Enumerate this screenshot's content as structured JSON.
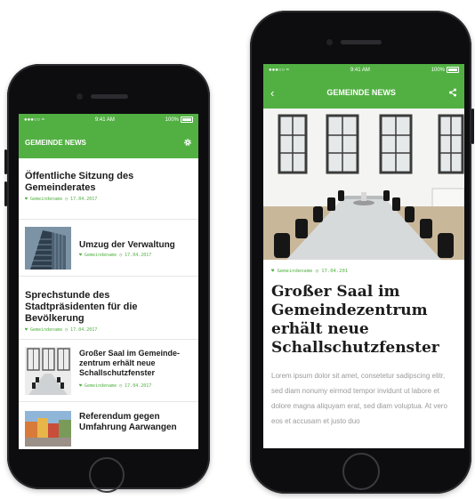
{
  "left_phone": {
    "status": {
      "carrier": "●●●○○ ≈",
      "time": "9:41 AM",
      "battery": "100%"
    },
    "appbar": {
      "title": "GEMEINDE NEWS",
      "settings_icon": "gear-icon"
    },
    "items": [
      {
        "title": "Öffentliche Sitzung des Gemeinderates",
        "meta": "♥ Gemeindename ◷ 17.04.2017"
      },
      {
        "title": "Umzug der Verwaltung",
        "meta": "♥ Gemeindename ◷ 17.04.2017"
      },
      {
        "title": "Sprechstunde des Stadtpräsidenten für die Bevölkerung",
        "meta": "♥ Gemeindename ◷ 17.04.2017"
      },
      {
        "title": "Großer Saal im Gemeinde-zentrum erhält neue Schallschutzfenster",
        "meta": "♥ Gemeindename ◷ 17.04.2017"
      },
      {
        "title": "Referendum gegen Umfahrung Aarwangen",
        "meta": ""
      }
    ]
  },
  "right_phone": {
    "status": {
      "carrier": "●●●○○ ≈",
      "time": "9:41 AM",
      "battery": "100%"
    },
    "appbar": {
      "title": "GEMEINDE NEWS",
      "back_icon": "back-chevron-icon",
      "share_icon": "share-icon"
    },
    "article": {
      "meta": "♥ Gemeindename ◷ 17.04.201",
      "headline": "Großer Saal im Gemeindezentrum erhält neue Schallschutzfenster",
      "body": "Lorem ipsum dolor sit amet, consetetur sadipscing elitr, sed diam nonumy eirmod tempor invidunt ut labore et dolore magna aliquyam erat, sed diam voluptua. At vero eos et accusam et justo duo"
    }
  },
  "colors": {
    "accent": "#52b043",
    "device": "#0d0d0f"
  }
}
